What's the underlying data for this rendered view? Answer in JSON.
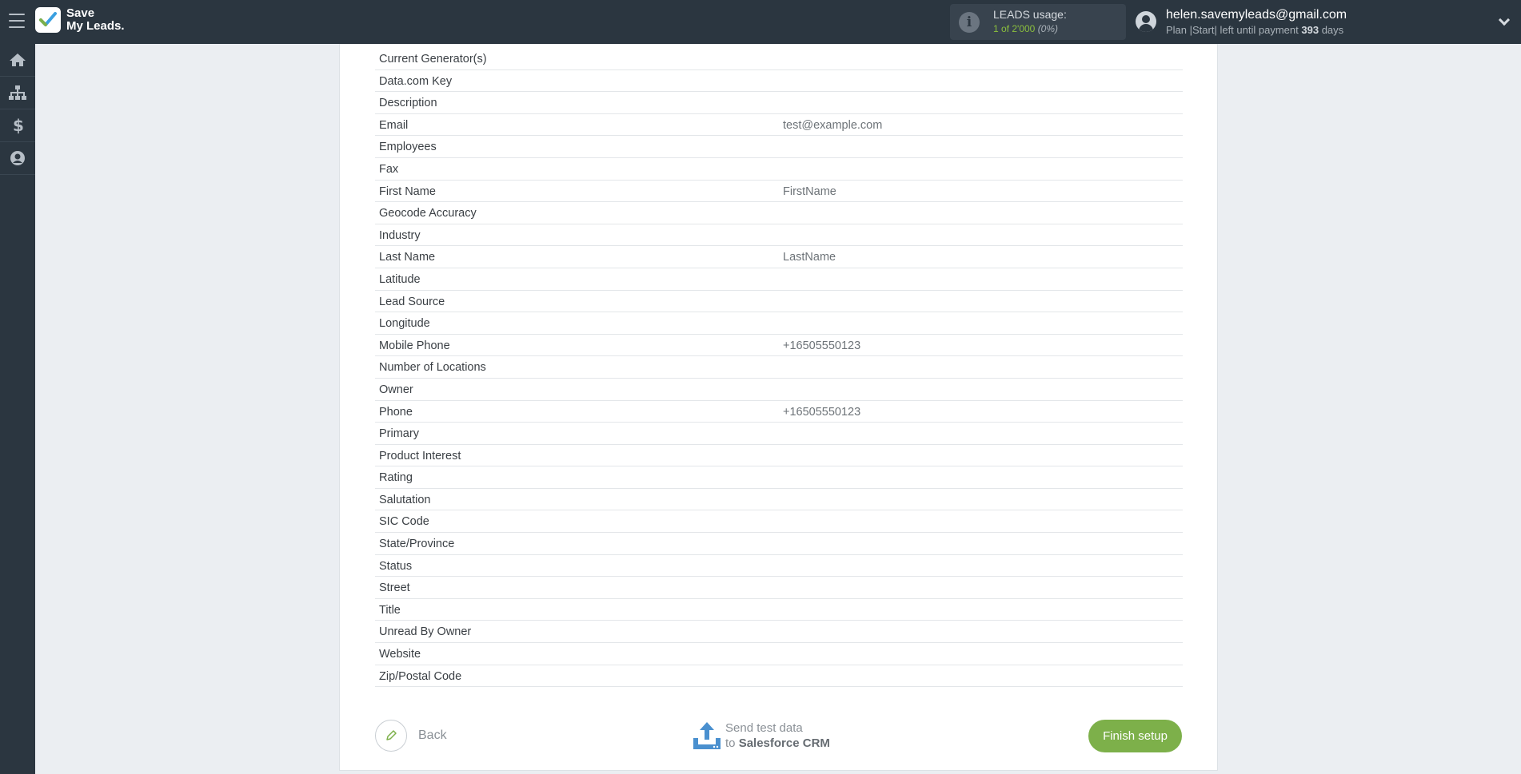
{
  "header": {
    "logo_line1": "Save",
    "logo_line2": "My Leads.",
    "usage_title": "LEADS usage:",
    "usage_count": "1 of 2'000",
    "usage_percent": "(0%)",
    "user_email": "helen.savemyleads@gmail.com",
    "plan_prefix": "Plan |Start| left until payment",
    "plan_days": "393",
    "plan_suffix": "days"
  },
  "sidebar": {
    "items": [
      {
        "icon": "home-icon"
      },
      {
        "icon": "sitemap-icon"
      },
      {
        "icon": "dollar-icon"
      },
      {
        "icon": "user-circle-icon"
      }
    ]
  },
  "fields": [
    {
      "name": "Current Generator(s)",
      "value": ""
    },
    {
      "name": "Data.com Key",
      "value": ""
    },
    {
      "name": "Description",
      "value": ""
    },
    {
      "name": "Email",
      "value": "test@example.com"
    },
    {
      "name": "Employees",
      "value": ""
    },
    {
      "name": "Fax",
      "value": ""
    },
    {
      "name": "First Name",
      "value": "FirstName"
    },
    {
      "name": "Geocode Accuracy",
      "value": ""
    },
    {
      "name": "Industry",
      "value": ""
    },
    {
      "name": "Last Name",
      "value": "LastName"
    },
    {
      "name": "Latitude",
      "value": ""
    },
    {
      "name": "Lead Source",
      "value": ""
    },
    {
      "name": "Longitude",
      "value": ""
    },
    {
      "name": "Mobile Phone",
      "value": "+16505550123"
    },
    {
      "name": "Number of Locations",
      "value": ""
    },
    {
      "name": "Owner",
      "value": ""
    },
    {
      "name": "Phone",
      "value": "+16505550123"
    },
    {
      "name": "Primary",
      "value": ""
    },
    {
      "name": "Product Interest",
      "value": ""
    },
    {
      "name": "Rating",
      "value": ""
    },
    {
      "name": "Salutation",
      "value": ""
    },
    {
      "name": "SIC Code",
      "value": ""
    },
    {
      "name": "State/Province",
      "value": ""
    },
    {
      "name": "Status",
      "value": ""
    },
    {
      "name": "Street",
      "value": ""
    },
    {
      "name": "Title",
      "value": ""
    },
    {
      "name": "Unread By Owner",
      "value": ""
    },
    {
      "name": "Website",
      "value": ""
    },
    {
      "name": "Zip/Postal Code",
      "value": ""
    }
  ],
  "footer": {
    "back_label": "Back",
    "send_line1": "Send test data",
    "send_to": "to",
    "send_target": "Salesforce CRM",
    "finish_label": "Finish setup"
  },
  "colors": {
    "topbar": "#2b3640",
    "accent_green": "#7db04a",
    "upload_blue": "#4a90cf"
  }
}
